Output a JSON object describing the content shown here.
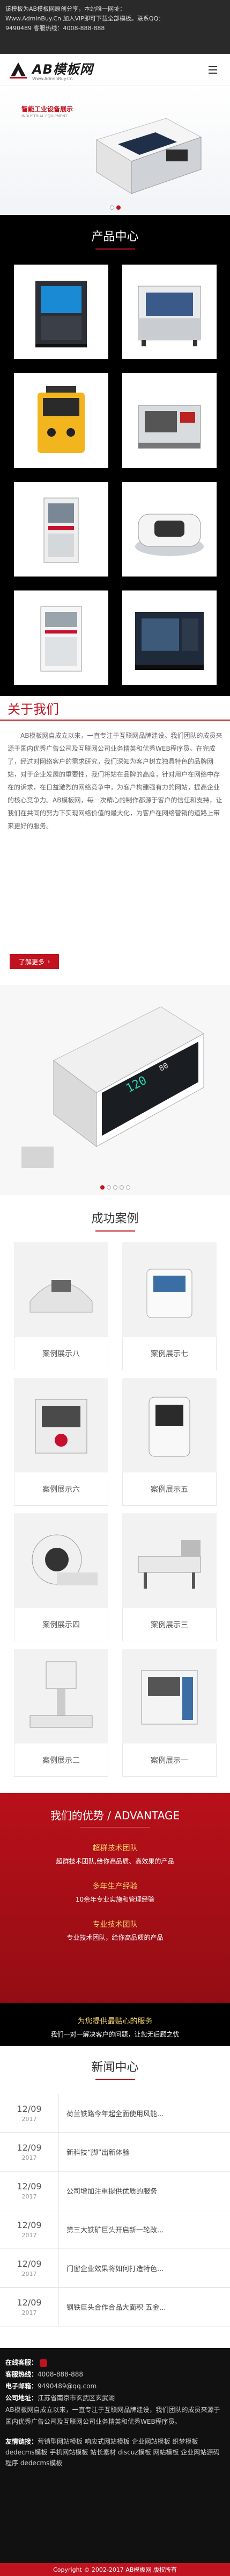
{
  "notice": {
    "lines": [
      "该模板为AB模板网原创分享，本站唯一网址：",
      "Www.AdminBuy.Cn 加入VIP即可下载全部模板。联系QQ：",
      "9490489 客服热线：4008-888-888"
    ]
  },
  "header": {
    "logo_text": "AB模板网",
    "logo_sub": "Www.AdminBuy.Cn"
  },
  "banner": {
    "title": "智能工业设备展示",
    "subtitle": "INDUSTRIAL EQUIPMENT",
    "dots": 2,
    "active_dot": 1
  },
  "products": {
    "title": "产品中心"
  },
  "about": {
    "title": "关于我们",
    "text": "AB模板网自成立以来，一直专注于互联网品牌建设。我们团队的成员来源于国内优秀广告公司及互联网公司业务精英和优秀WEB程序员。在完成了，经过对网络客户的需求研究，我们深知为客户树立独具特色的品牌网站，对于企业发展的重要性，我们将站在品牌的高度，针对用户在网络中存在的诉求，在日益激烈的网络竞争中，为客户构建强有力的网站，提高企业的核心竞争力。AB模板网，每一次精心的制作都源于客户的信任和支持，让我们在共同的努力下实现网络价值的最大化，为客户在网络营销的道路上带来更好的服务。",
    "more_label": "了解更多"
  },
  "slider": {
    "dots": 5,
    "active_dot": 0
  },
  "cases": {
    "title": "成功案例",
    "items": [
      {
        "label": "案例展示八"
      },
      {
        "label": "案例展示七"
      },
      {
        "label": "案例展示六"
      },
      {
        "label": "案例展示五"
      },
      {
        "label": "案例展示四"
      },
      {
        "label": "案例展示三"
      },
      {
        "label": "案例展示二"
      },
      {
        "label": "案例展示一"
      }
    ]
  },
  "advantage": {
    "title": "我们的优势 / ADVANTAGE",
    "items": [
      {
        "title": "超群技术团队",
        "desc": "超群技术团队,给你高品质、高效果的产品"
      },
      {
        "title": "多年生产经验",
        "desc": "10余年专业实施和管理经验"
      },
      {
        "title": "专业技术团队",
        "desc": "专业技术团队，给你高品质的产品"
      },
      {
        "title": "为您提供最贴心的服务",
        "desc": "我们一对一解决客户的问题，让您无后顾之忧"
      }
    ]
  },
  "news": {
    "title": "新闻中心",
    "items": [
      {
        "md": "12/09",
        "year": "2017",
        "title": "荷兰铁路今年起全面使用风能..."
      },
      {
        "md": "12/09",
        "year": "2017",
        "title": "新科技“脚”出新体验"
      },
      {
        "md": "12/09",
        "year": "2017",
        "title": "公司增加注重提供优质的服务"
      },
      {
        "md": "12/09",
        "year": "2017",
        "title": "第三大铁矿巨头开启新一轮改..."
      },
      {
        "md": "12/09",
        "year": "2017",
        "title": "门窗企业效果将如何打造特色..."
      },
      {
        "md": "12/09",
        "year": "2017",
        "title": "钢铁巨头合作合品大面积 五金..."
      }
    ]
  },
  "footer": {
    "online_label": "在线客服：",
    "phone_label": "客服热线：",
    "phone": "4008-888-888",
    "email_label": "电子邮箱：",
    "email": "9490489@qq.com",
    "address_label": "公司地址：",
    "address": "江苏省南京市玄武区玄武湖",
    "desc": "AB模板网自成立以来，一直专注于互联网品牌建设，我们团队的成员来源于国内优秀广告公司及互联网公司业务精英和优秀WEB程序员。",
    "links_label": "友情链接：",
    "links": "营销型网站模板  响应式网站模板  企业网站模板  织梦模板  dedecms模板  手机网站模板  站长素材  discuz模板  网站模板  企业网站源码  程序  dedecms模板",
    "copyright": "Copyright © 2002-2017 AB模板网 版权所有"
  }
}
